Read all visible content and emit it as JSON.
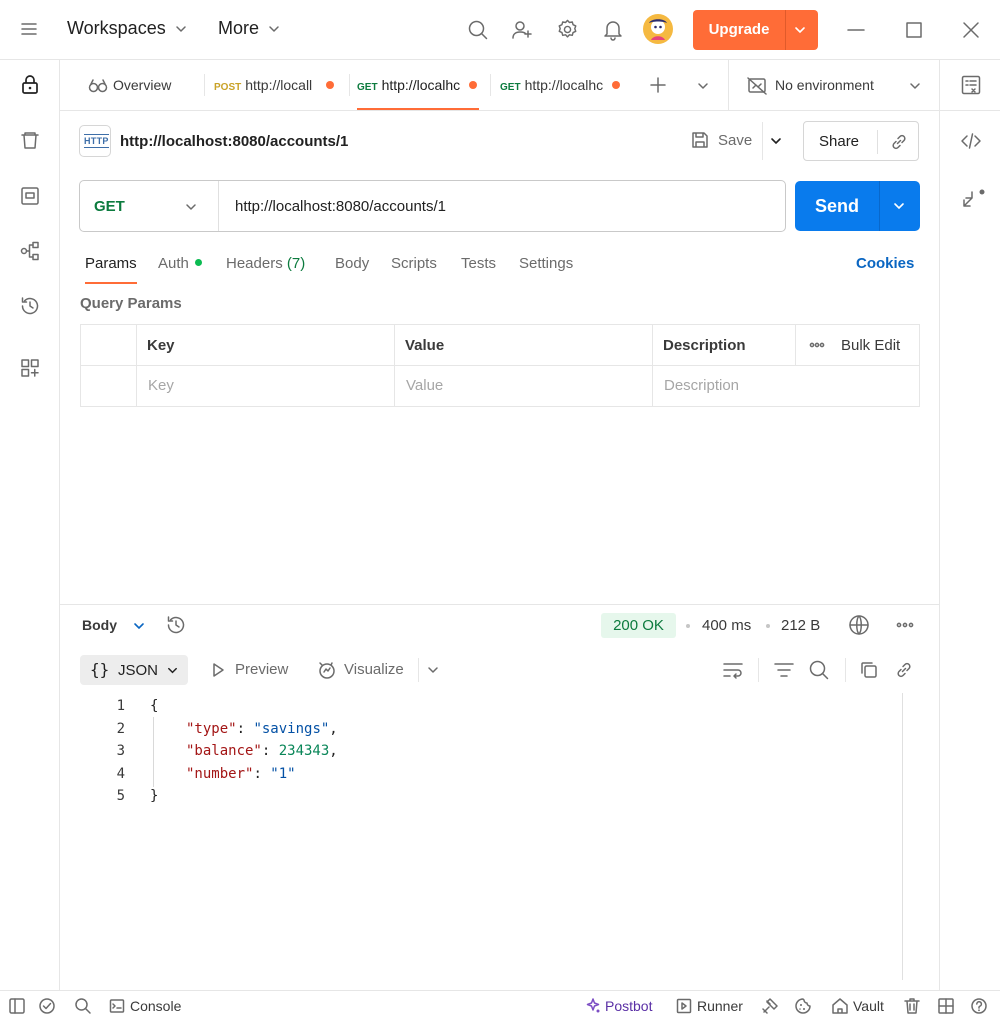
{
  "titlebar": {
    "workspaces": "Workspaces",
    "more": "More",
    "upgrade": "Upgrade"
  },
  "tabs": {
    "overview": "Overview",
    "items": [
      {
        "method": "POST",
        "url": "http://locall",
        "method_color": "#c9a227"
      },
      {
        "method": "GET",
        "url": "http://localhc",
        "method_color": "#0c7b3e"
      },
      {
        "method": "GET",
        "url": "http://localhc",
        "method_color": "#0c7b3e"
      }
    ],
    "environment": "No environment"
  },
  "request": {
    "badge": "HTTP",
    "title": "http://localhost:8080/accounts/1",
    "save": "Save",
    "share": "Share",
    "method": "GET",
    "url": "http://localhost:8080/accounts/1",
    "send": "Send"
  },
  "request_tabs": {
    "params": "Params",
    "auth": "Auth",
    "headers": "Headers",
    "headers_count": "(7)",
    "body": "Body",
    "scripts": "Scripts",
    "tests": "Tests",
    "settings": "Settings",
    "cookies": "Cookies"
  },
  "query_params": {
    "title": "Query Params",
    "columns": [
      "Key",
      "Value",
      "Description"
    ],
    "bulk_edit": "Bulk Edit",
    "placeholders": [
      "Key",
      "Value",
      "Description"
    ]
  },
  "response": {
    "body": "Body",
    "status": "200 OK",
    "time": "400 ms",
    "size": "212 B",
    "format": "JSON",
    "preview": "Preview",
    "visualize": "Visualize",
    "lines": [
      {
        "n": "1",
        "text": "{"
      },
      {
        "n": "2",
        "key": "\"type\"",
        "value": "\"savings\"",
        "kind": "string",
        "comma": ","
      },
      {
        "n": "3",
        "key": "\"balance\"",
        "value": "234343",
        "kind": "number",
        "comma": ","
      },
      {
        "n": "4",
        "key": "\"number\"",
        "value": "\"1\"",
        "kind": "string",
        "comma": ""
      },
      {
        "n": "5",
        "text": "}"
      }
    ]
  },
  "statusbar": {
    "console": "Console",
    "postbot": "Postbot",
    "runner": "Runner",
    "vault": "Vault"
  },
  "colors": {
    "accent": "#ff6c37",
    "send": "#097bed",
    "ok_bg": "#e6f7ec",
    "ok_text": "#0c7b3e",
    "cookies": "#0a66c2"
  }
}
